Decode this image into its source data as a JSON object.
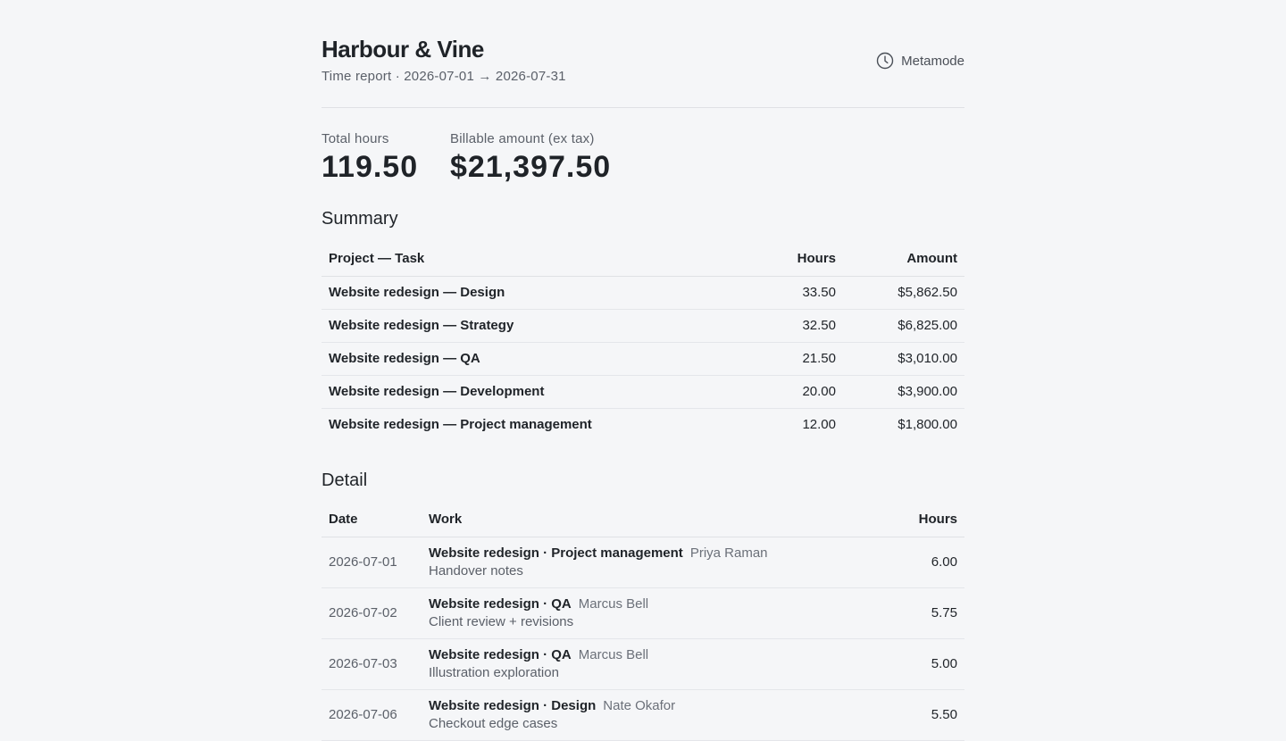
{
  "header": {
    "client_name": "Harbour & Vine",
    "subtitle": "Time report · 2026-07-01 → 2026-07-31",
    "brand_name": "Metamode",
    "brand_icon": "clock-icon"
  },
  "totals": {
    "hours_label": "Total hours",
    "hours_value": "119.50",
    "amount_label": "Billable amount (ex tax)",
    "amount_value": "$21,397.50"
  },
  "summary": {
    "title": "Summary",
    "columns": {
      "task": "Project — Task",
      "hours": "Hours",
      "amount": "Amount"
    },
    "rows": [
      {
        "task": "Website redesign — Design",
        "hours": "33.50",
        "amount": "$5,862.50"
      },
      {
        "task": "Website redesign — Strategy",
        "hours": "32.50",
        "amount": "$6,825.00"
      },
      {
        "task": "Website redesign — QA",
        "hours": "21.50",
        "amount": "$3,010.00"
      },
      {
        "task": "Website redesign — Development",
        "hours": "20.00",
        "amount": "$3,900.00"
      },
      {
        "task": "Website redesign — Project management",
        "hours": "12.00",
        "amount": "$1,800.00"
      }
    ]
  },
  "detail": {
    "title": "Detail",
    "columns": {
      "date": "Date",
      "work": "Work",
      "hours": "Hours"
    },
    "rows": [
      {
        "date": "2026-07-01",
        "task": "Website redesign · Project management",
        "person": "Priya Raman",
        "note": "Handover notes",
        "hours": "6.00"
      },
      {
        "date": "2026-07-02",
        "task": "Website redesign · QA",
        "person": "Marcus Bell",
        "note": "Client review + revisions",
        "hours": "5.75"
      },
      {
        "date": "2026-07-03",
        "task": "Website redesign · QA",
        "person": "Marcus Bell",
        "note": "Illustration exploration",
        "hours": "5.00"
      },
      {
        "date": "2026-07-06",
        "task": "Website redesign · Design",
        "person": "Nate Okafor",
        "note": "Checkout edge cases",
        "hours": "5.50"
      }
    ]
  }
}
